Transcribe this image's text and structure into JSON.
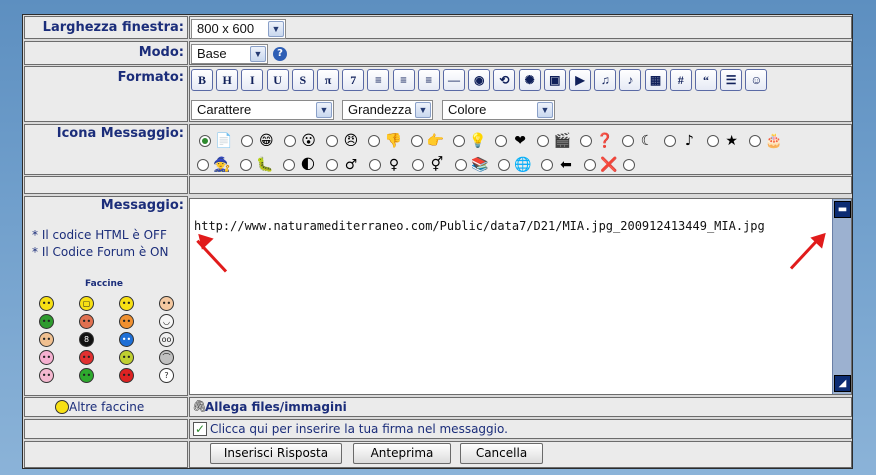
{
  "labels": {
    "window_width": "Larghezza finestra:",
    "mode": "Modo:",
    "format": "Formato:",
    "icon": "Icona Messaggio:",
    "message": "Messaggio:"
  },
  "window_width": {
    "value": "800 x 600"
  },
  "mode": {
    "value": "Base",
    "help": "?"
  },
  "toolbar": [
    {
      "name": "bold-button",
      "glyph": "B"
    },
    {
      "name": "heading-button",
      "glyph": "H"
    },
    {
      "name": "italic-button",
      "glyph": "I"
    },
    {
      "name": "underline-button",
      "glyph": "U"
    },
    {
      "name": "strike-button",
      "glyph": "S"
    },
    {
      "name": "pi-button",
      "glyph": "π"
    },
    {
      "name": "font-button",
      "glyph": "7"
    },
    {
      "name": "align-left-button",
      "glyph": "≡"
    },
    {
      "name": "align-center-button",
      "glyph": "≡"
    },
    {
      "name": "align-right-button",
      "glyph": "≡"
    },
    {
      "name": "hr-button",
      "glyph": "—"
    },
    {
      "name": "globe-button",
      "glyph": "◉"
    },
    {
      "name": "link-button",
      "glyph": "⟲"
    },
    {
      "name": "flash-button",
      "glyph": "✺"
    },
    {
      "name": "image-button",
      "glyph": "▣"
    },
    {
      "name": "youtube-button",
      "glyph": "▶"
    },
    {
      "name": "wmv-button",
      "glyph": "♫"
    },
    {
      "name": "mp3-button",
      "glyph": "♪"
    },
    {
      "name": "table-button",
      "glyph": "▦"
    },
    {
      "name": "hash-button",
      "glyph": "#"
    },
    {
      "name": "quote-button",
      "glyph": "“"
    },
    {
      "name": "list-button",
      "glyph": "☰"
    },
    {
      "name": "smiley-button",
      "glyph": "☺"
    }
  ],
  "selects": {
    "font": "Carattere",
    "size": "Grandezza",
    "color": "Colore"
  },
  "icons": [
    "📄",
    "😁",
    "😮",
    "😠",
    "👎",
    "👉",
    "💡",
    "❤",
    "🎬",
    "❓",
    "☾",
    "♪",
    "★",
    "🎂",
    "🧙",
    "🐛",
    "🌓",
    "♂",
    "♀",
    "⚥",
    "📚",
    "🌐",
    "⬅",
    "❌"
  ],
  "message_text": "http://www.naturamediterraneo.com/Public/data7/D21/MIA.jpg_200912413449_MIA.jpg",
  "hints": {
    "html_off": "* Il codice HTML è OFF",
    "forum_on": "* Il Codice Forum è ON"
  },
  "faccine": {
    "title": "Faccine",
    "colors": [
      "#f7e014",
      "#f7e014",
      "#f7e014",
      "#f4c8a0",
      "#2e9b2e",
      "#e07050",
      "#f09030",
      "#f6f6f6",
      "#f0c090",
      "#111111",
      "#1e6fd6",
      "#f0f0f0",
      "#f5b0d0",
      "#e03030",
      "#c0d030",
      "#c0c0c0",
      "#f5b8d0",
      "#2eaa2e",
      "#dd2222",
      "#ffffff"
    ],
    "glyphs": [
      "••",
      "▢",
      "••",
      "••",
      "••",
      "••",
      "••",
      "◡",
      "••",
      "8",
      "••",
      "oo",
      "••",
      "••",
      "••",
      "⌒",
      "••",
      "••",
      "••",
      "?"
    ]
  },
  "more_smileys": "Altre faccine",
  "attach": "Allega files/immagini",
  "signature": "Clicca qui per inserire la tua firma nel messaggio.",
  "buttons": {
    "submit": "Inserisci Risposta",
    "preview": "Anteprima",
    "cancel": "Cancella"
  },
  "colors": {
    "label": "#1b2d7a",
    "arrow": "#e11b1b",
    "checkbox": "#2e8a2e"
  }
}
